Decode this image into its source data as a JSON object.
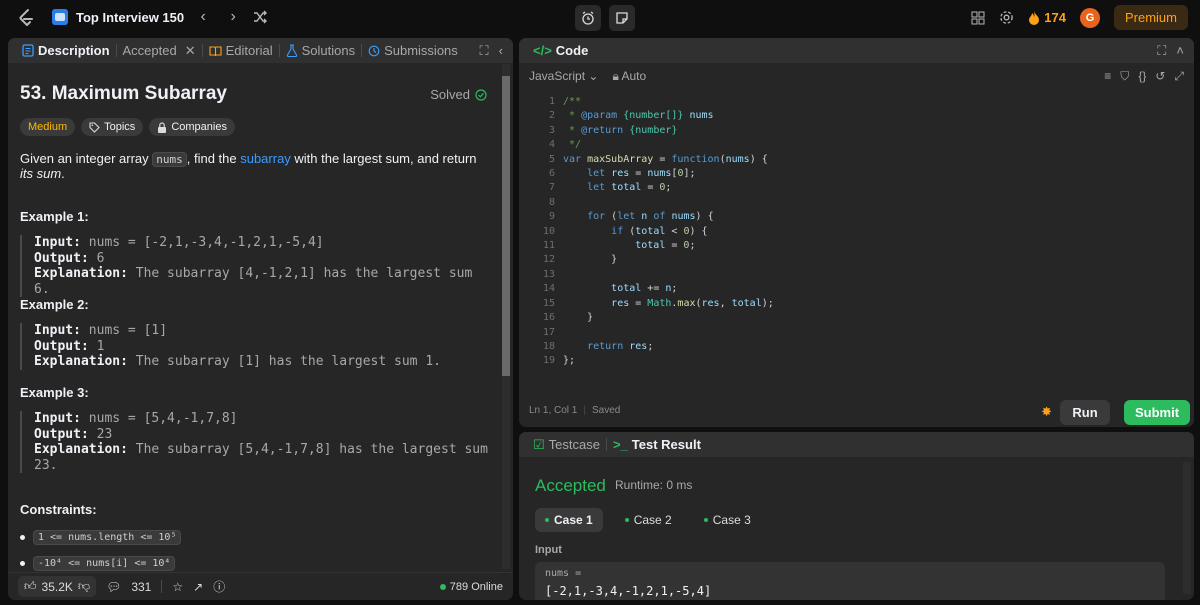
{
  "topbar": {
    "list_title": "Top Interview 150",
    "streak": "174",
    "avatar_letter": "G",
    "premium_label": "Premium"
  },
  "left_tabs": {
    "description": "Description",
    "accepted": "Accepted",
    "editorial": "Editorial",
    "solutions": "Solutions",
    "submissions": "Submissions"
  },
  "problem": {
    "title": "53. Maximum Subarray",
    "status": "Solved",
    "difficulty": "Medium",
    "topics_label": "Topics",
    "companies_label": "Companies",
    "statement_pre": "Given an integer array ",
    "statement_code": "nums",
    "statement_mid": ", find the ",
    "statement_link": "subarray",
    "statement_post": " with the largest sum, and return ",
    "statement_em": "its sum",
    "statement_end": "."
  },
  "examples": [
    {
      "heading": "Example 1:",
      "input_label": "Input:",
      "input": " nums = [-2,1,-3,4,-1,2,1,-5,4]",
      "output_label": "Output:",
      "output": " 6",
      "expl_label": "Explanation:",
      "expl": " The subarray [4,-1,2,1] has the largest sum 6."
    },
    {
      "heading": "Example 2:",
      "input_label": "Input:",
      "input": " nums = [1]",
      "output_label": "Output:",
      "output": " 1",
      "expl_label": "Explanation:",
      "expl": " The subarray [1] has the largest sum 1."
    },
    {
      "heading": "Example 3:",
      "input_label": "Input:",
      "input": " nums = [5,4,-1,7,8]",
      "output_label": "Output:",
      "output": " 23",
      "expl_label": "Explanation:",
      "expl": " The subarray [5,4,-1,7,8] has the largest sum 23."
    }
  ],
  "constraints": {
    "heading": "Constraints:",
    "c1": "1 <= nums.length <= 10⁵",
    "c2": "-10⁴ <= nums[i] <= 10⁴"
  },
  "left_footer": {
    "likes": "35.2K",
    "comments": "331",
    "online": "789 Online"
  },
  "code_panel": {
    "title": "Code",
    "language": "JavaScript",
    "auto": "Auto",
    "cursor": "Ln 1, Col 1",
    "saved": "Saved",
    "run_label": "Run",
    "submit_label": "Submit",
    "line_numbers": [
      "1",
      "2",
      "3",
      "4",
      "5",
      "6",
      "7",
      "8",
      "9",
      "10",
      "11",
      "12",
      "13",
      "14",
      "15",
      "16",
      "17",
      "18",
      "19"
    ]
  },
  "result": {
    "tab_testcase": "Testcase",
    "tab_result": "Test Result",
    "verdict": "Accepted",
    "runtime": "Runtime: 0 ms",
    "case1": "Case 1",
    "case2": "Case 2",
    "case3": "Case 3",
    "input_label": "Input",
    "param_name": "nums =",
    "param_value": "[-2,1,-3,4,-1,2,1,-5,4]"
  }
}
